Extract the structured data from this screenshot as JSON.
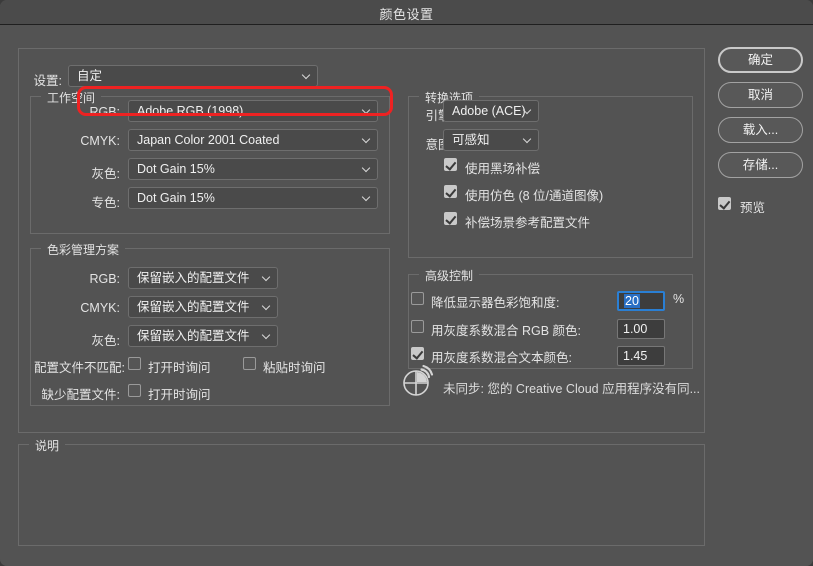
{
  "window": {
    "title": "颜色设置"
  },
  "settings": {
    "label": "设置:",
    "value": "自定"
  },
  "working_spaces": {
    "legend": "工作空间",
    "rows": [
      {
        "label": "RGB:",
        "value": "Adobe RGB (1998)"
      },
      {
        "label": "CMYK:",
        "value": "Japan Color 2001 Coated"
      },
      {
        "label": "灰色:",
        "value": "Dot Gain 15%"
      },
      {
        "label": "专色:",
        "value": "Dot Gain 15%"
      }
    ]
  },
  "color_management_policies": {
    "legend": "色彩管理方案",
    "rows": [
      {
        "label": "RGB:",
        "value": "保留嵌入的配置文件"
      },
      {
        "label": "CMYK:",
        "value": "保留嵌入的配置文件"
      },
      {
        "label": "灰色:",
        "value": "保留嵌入的配置文件"
      }
    ],
    "profile_mismatches": {
      "label": "配置文件不匹配:",
      "ask_when_opening": {
        "label": "打开时询问",
        "checked": false
      },
      "ask_when_pasting": {
        "label": "粘贴时询问",
        "checked": false
      }
    },
    "missing_profiles": {
      "label": "缺少配置文件:",
      "ask_when_opening": {
        "label": "打开时询问",
        "checked": false
      }
    }
  },
  "conversion_options": {
    "legend": "转换选项",
    "engine": {
      "label": "引擎:",
      "value": "Adobe (ACE)"
    },
    "intent": {
      "label": "意图:",
      "value": "可感知"
    },
    "checkboxes": [
      {
        "label": "使用黑场补偿",
        "checked": true
      },
      {
        "label": "使用仿色 (8 位/通道图像)",
        "checked": true
      },
      {
        "label": "补偿场景参考配置文件",
        "checked": true
      }
    ]
  },
  "advanced_controls": {
    "legend": "高级控制",
    "rows": [
      {
        "label": "降低显示器色彩饱和度:",
        "checked": false,
        "value": "20",
        "suffix": "%",
        "focused": true
      },
      {
        "label": "用灰度系数混合 RGB 颜色:",
        "checked": false,
        "value": "1.00",
        "suffix": "",
        "focused": false
      },
      {
        "label": "用灰度系数混合文本颜色:",
        "checked": true,
        "value": "1.45",
        "suffix": "",
        "focused": false
      }
    ]
  },
  "sync_status": {
    "icon": "creative-cloud-sync-icon",
    "text": "未同步: 您的 Creative Cloud 应用程序没有同..."
  },
  "description": {
    "legend": "说明",
    "text": ""
  },
  "buttons": {
    "ok": "确定",
    "cancel": "取消",
    "load": "载入...",
    "save": "存储...",
    "preview": {
      "label": "预览",
      "checked": true
    }
  },
  "colors": {
    "window_bg": "#535353",
    "titlebar_bg": "#4b4b4b",
    "highlight": "#ee2222",
    "focus_blue": "#2a7fd4",
    "selection_blue": "#2a6fc4"
  }
}
